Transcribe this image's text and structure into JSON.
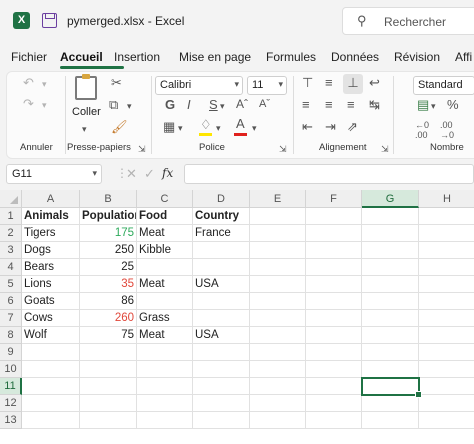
{
  "window": {
    "title": "pymerged.xlsx  -  Excel"
  },
  "search": {
    "placeholder": "Rechercher"
  },
  "tabs": [
    {
      "label": "Fichier"
    },
    {
      "label": "Accueil"
    },
    {
      "label": "Insertion"
    },
    {
      "label": "Mise en page"
    },
    {
      "label": "Formules"
    },
    {
      "label": "Données"
    },
    {
      "label": "Révision"
    },
    {
      "label": "Affi"
    }
  ],
  "ribbon": {
    "groups": {
      "undo": "Annuler",
      "clipboard": "Presse-papiers",
      "font": "Police",
      "alignment": "Alignement",
      "number": "Nombre"
    },
    "paste_label": "Coller",
    "font_name": "Calibri",
    "font_size": "11",
    "number_format": "Standard",
    "bold": "G",
    "italic": "I",
    "underline": "S"
  },
  "formula_bar": {
    "name_box": "G11",
    "fx": "fx",
    "formula": ""
  },
  "columns": [
    "A",
    "B",
    "C",
    "D",
    "E",
    "F",
    "G",
    "H"
  ],
  "rows": [
    "1",
    "2",
    "3",
    "4",
    "5",
    "6",
    "7",
    "8",
    "9",
    "10",
    "11",
    "12",
    "13"
  ],
  "cells": {
    "header": {
      "A": "Animals",
      "B": "Population",
      "C": "Food",
      "D": "Country"
    },
    "data": [
      {
        "A": "Tigers",
        "B": "175",
        "C": "Meat",
        "D": "France"
      },
      {
        "A": "Dogs",
        "B": "250",
        "C": "Kibble",
        "D": ""
      },
      {
        "A": "Bears",
        "B": "25",
        "C": "",
        "D": ""
      },
      {
        "A": "Lions",
        "B": "35",
        "C": "Meat",
        "D": "USA"
      },
      {
        "A": "Goats",
        "B": "86",
        "C": "",
        "D": ""
      },
      {
        "A": "Cows",
        "B": "260",
        "C": "Grass",
        "D": ""
      },
      {
        "A": "Wolf",
        "B": "75",
        "C": "Meat",
        "D": "USA"
      }
    ]
  },
  "selected_cell": "G11",
  "colors": {
    "accent": "#1f7244",
    "green_value": "#2eaa5c",
    "red_value": "#e0473a"
  }
}
